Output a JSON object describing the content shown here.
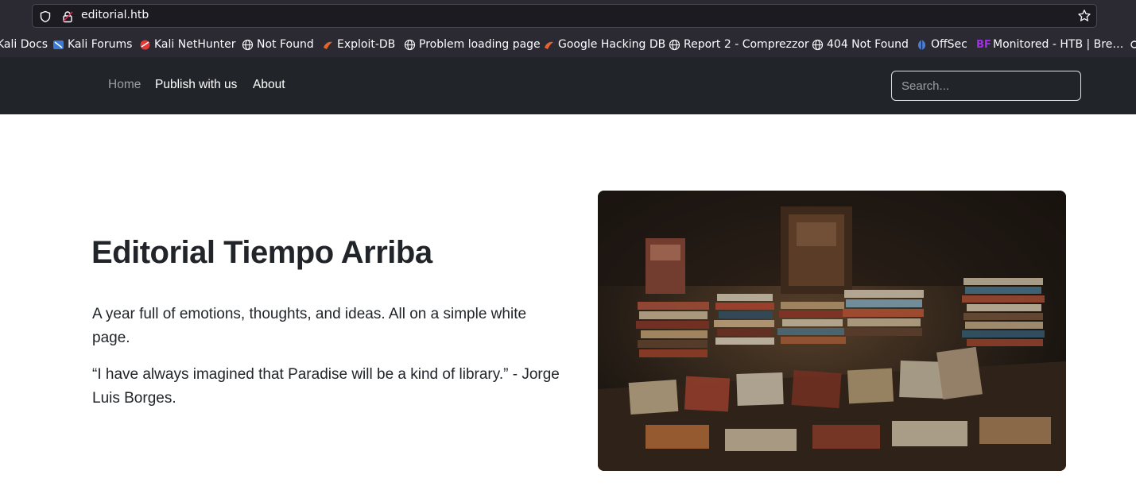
{
  "browser": {
    "url": "editorial.htb",
    "bookmarks": [
      {
        "label": "Kali Docs",
        "icon": "kali-docs-icon"
      },
      {
        "label": "Kali Forums",
        "icon": "kali-forums-icon"
      },
      {
        "label": "Kali NetHunter",
        "icon": "kali-nethunter-icon"
      },
      {
        "label": "Not Found",
        "icon": "globe-icon"
      },
      {
        "label": "Exploit-DB",
        "icon": "exploit-db-icon"
      },
      {
        "label": "Problem loading page",
        "icon": "globe-icon"
      },
      {
        "label": "Google Hacking DB",
        "icon": "exploit-db-icon"
      },
      {
        "label": "Report 2 - Comprezzor",
        "icon": "globe-icon"
      },
      {
        "label": "404 Not Found",
        "icon": "globe-icon"
      },
      {
        "label": "OffSec",
        "icon": "offsec-icon"
      },
      {
        "label": "Monitored - HTB | Bre…",
        "icon": "bf-icon"
      }
    ]
  },
  "nav": {
    "home": "Home",
    "publish": "Publish with us",
    "about": "About",
    "search_placeholder": "Search..."
  },
  "hero": {
    "title": "Editorial Tiempo Arriba",
    "paragraph1": "A year full of emotions, thoughts, and ideas. All on a simple white page.",
    "paragraph2": "“I have always imagined that Paradise will be a kind of library.” - Jorge Luis Borges."
  },
  "colors": {
    "navbar": "#212529",
    "chrome": "#2b2a33",
    "text": "#212529"
  }
}
